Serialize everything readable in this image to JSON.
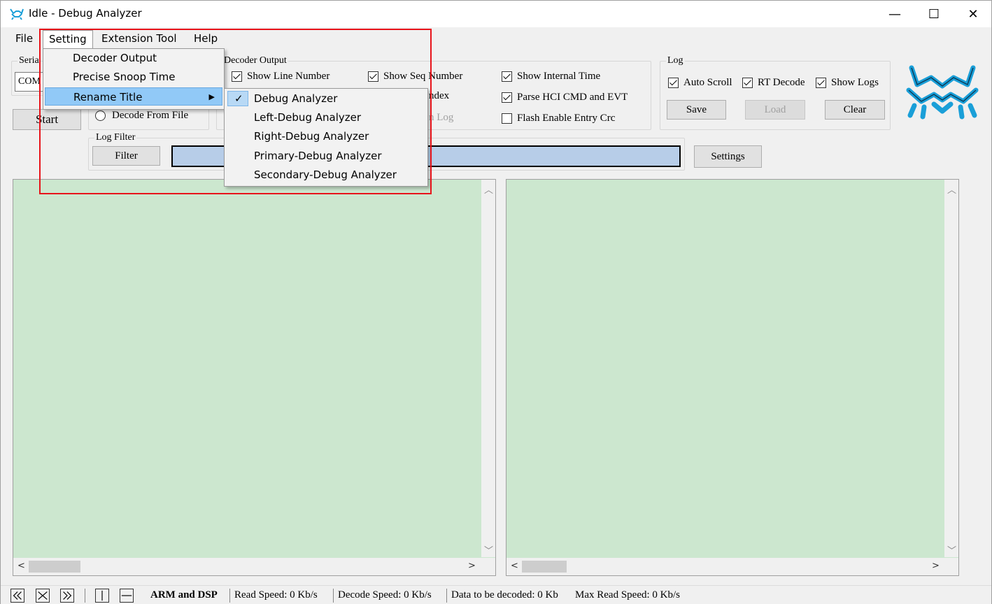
{
  "window": {
    "title": "Idle - Debug Analyzer",
    "minimize": "—",
    "maximize": "☐",
    "close": "✕"
  },
  "menubar": [
    "File",
    "Setting",
    "Extension Tool",
    "Help"
  ],
  "left_panel": {
    "serial_label": "Seria",
    "combo_value": "COM",
    "start_label": "Start",
    "decode_from_file": "Decode From File"
  },
  "decoder_output": {
    "label": "Decoder Output",
    "show_line_number": "Show Line Number",
    "show_seq_number": "Show Seq Number",
    "show_internal_time": "Show Internal Time",
    "index_partial": "ndex",
    "parse_hci": "Parse HCI CMD and EVT",
    "log_partial": "n Log",
    "flash_enable": "Flash Enable Entry Crc"
  },
  "log_group": {
    "label": "Log",
    "auto_scroll": "Auto Scroll",
    "rt_decode": "RT Decode",
    "show_logs": "Show Logs",
    "save": "Save",
    "load": "Load",
    "clear": "Clear"
  },
  "log_filter": {
    "label": "Log Filter",
    "filter_button": "Filter",
    "settings_button": "Settings",
    "input_value": ""
  },
  "setting_menu": {
    "items": [
      "Decoder Output",
      "Precise Snoop Time",
      "Rename Title"
    ]
  },
  "rename_submenu": {
    "items": [
      "Debug Analyzer",
      "Left-Debug Analyzer",
      "Right-Debug Analyzer",
      "Primary-Debug Analyzer",
      "Secondary-Debug Analyzer"
    ],
    "checked": "Debug Analyzer"
  },
  "statusbar": {
    "mode": "ARM and DSP",
    "read_speed": "Read Speed:  0 Kb/s",
    "decode_speed": "Decode Speed:  0 Kb/s",
    "data_to_decode": "Data to be decoded:  0 Kb",
    "max_read_speed": "Max Read Speed:  0 Kb/s"
  },
  "colors": {
    "pane_bg": "#cce7cf",
    "filter_input_bg": "#b7cde8",
    "menu_highlight": "#91c9f7",
    "annotation_border": "#e8141b",
    "logo_blue": "#1a9fd8"
  }
}
